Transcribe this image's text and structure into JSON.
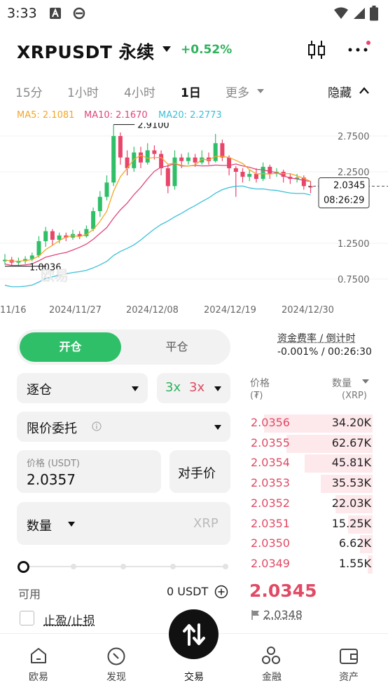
{
  "status_bar": {
    "time": "3:33"
  },
  "header": {
    "pair": "XRPUSDT 永续",
    "change": "+0.52%"
  },
  "timeframes": [
    "15分",
    "1小时",
    "4小时",
    "1日",
    "更多"
  ],
  "active_timeframe": "1日",
  "hide_label": "隐藏",
  "ma": {
    "ma5": "MA5: 2.1081",
    "ma10": "MA10: 2.1670",
    "ma20": "MA20: 2.2773",
    "ma5_color": "#f5a623",
    "ma10_color": "#e0457b",
    "ma20_color": "#3cc0d8"
  },
  "chart": {
    "y_ticks": [
      "2.7500",
      "2.2500",
      "1.2500",
      "0.7500"
    ],
    "x_ticks": [
      "11/16",
      "2024/11/27",
      "2024/12/08",
      "2024/12/19",
      "2024/12/30"
    ],
    "high_label": "2.9100",
    "low_label": "1.0036",
    "current_price": "2.0345",
    "countdown": "08:26:29",
    "watermark": "欧易"
  },
  "order": {
    "open_label": "开仓",
    "close_label": "平仓",
    "margin_mode": "逐仓",
    "lev_long": "3x",
    "lev_short": "3x",
    "order_type": "限价委托",
    "price_label": "价格 (USDT)",
    "price_value": "2.0357",
    "counter_price": "对手价",
    "qty_label": "数量",
    "qty_unit": "XRP",
    "available_label": "可用",
    "available_value": "0 USDT",
    "tpsl_label": "止盈/止损"
  },
  "funding": {
    "title": "资金费率 / 倒计时",
    "value": "-0.001% / 00:26:30"
  },
  "orderbook": {
    "price_header": "价格",
    "price_unit": "(₮)",
    "qty_header": "数量",
    "qty_unit": "(XRP)",
    "asks": [
      {
        "price": "2.0356",
        "qty": "34.20K",
        "depth": 0.88
      },
      {
        "price": "2.0355",
        "qty": "62.67K",
        "depth": 0.7
      },
      {
        "price": "2.0354",
        "qty": "45.81K",
        "depth": 0.55
      },
      {
        "price": "2.0353",
        "qty": "35.53K",
        "depth": 0.42
      },
      {
        "price": "2.0352",
        "qty": "22.03K",
        "depth": 0.3
      },
      {
        "price": "2.0351",
        "qty": "15.25K",
        "depth": 0.2
      },
      {
        "price": "2.0350",
        "qty": "6.62K",
        "depth": 0.1
      },
      {
        "price": "2.0349",
        "qty": "1.55K",
        "depth": 0.04
      }
    ],
    "last_price": "2.0345",
    "mark_price": "2.0348"
  },
  "nav": {
    "home": "欧易",
    "discover": "发现",
    "trade": "交易",
    "finance": "金融",
    "assets": "资产"
  }
}
